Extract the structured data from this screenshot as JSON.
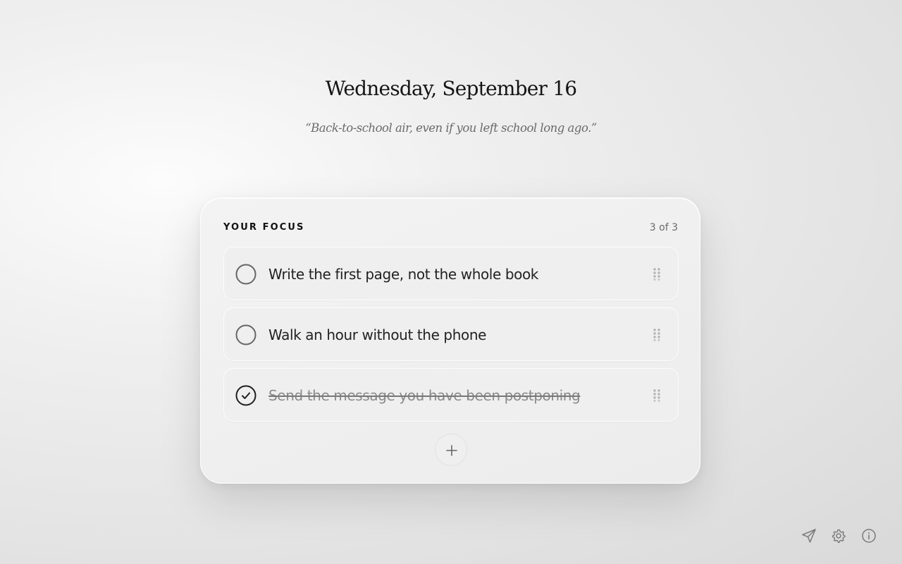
{
  "header": {
    "date": "Wednesday, September 16",
    "quote": "“Back-to-school air, even if you left school long ago.”"
  },
  "focus": {
    "label": "YOUR FOCUS",
    "counter": "3 of 3",
    "tasks": [
      {
        "text": "Write the first page, not the whole book",
        "done": false
      },
      {
        "text": "Walk an hour without the phone",
        "done": false
      },
      {
        "text": "Send the message you have been postponing",
        "done": true
      }
    ],
    "add_icon": "plus-icon"
  },
  "footer": {
    "icons": [
      "send-icon",
      "gear-icon",
      "info-icon"
    ]
  },
  "colors": {
    "text": "#1e1e1e",
    "muted": "#6b6b6b",
    "icon": "#7a7a7a"
  }
}
